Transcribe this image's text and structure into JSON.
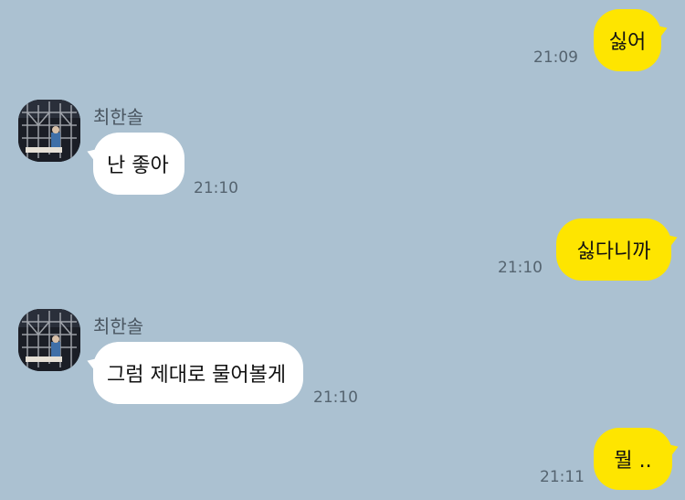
{
  "contact": {
    "name": "최한솔"
  },
  "messages": [
    {
      "from": "me",
      "text": "싫어",
      "time": "21:09"
    },
    {
      "from": "them",
      "text": "난 좋아",
      "time": "21:10"
    },
    {
      "from": "me",
      "text": "싫다니까",
      "time": "21:10"
    },
    {
      "from": "them",
      "text": "그럼 제대로 물어볼게",
      "time": "21:10"
    },
    {
      "from": "me",
      "text": "뭘 ..",
      "time": "21:11"
    }
  ],
  "colors": {
    "background": "#abc1d1",
    "my_bubble": "#fee500",
    "their_bubble": "#ffffff"
  }
}
